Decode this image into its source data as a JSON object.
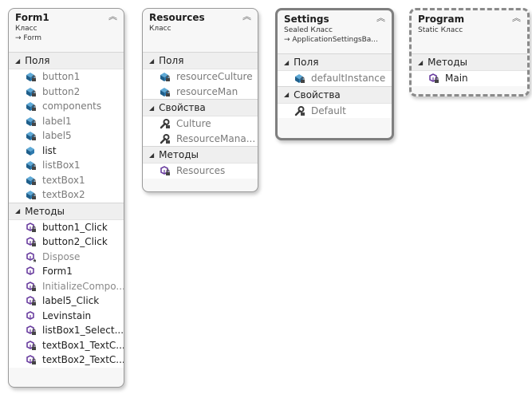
{
  "collapse_glyph": "︽",
  "form1": {
    "title": "Form1",
    "kind": "Класс",
    "base": "→ Form",
    "sections": {
      "fields": {
        "label": "Поля",
        "items": [
          {
            "name": "button1",
            "icon": "field-private-icon",
            "visibility": "private"
          },
          {
            "name": "button2",
            "icon": "field-private-icon",
            "visibility": "private"
          },
          {
            "name": "components",
            "icon": "field-private-icon",
            "visibility": "private"
          },
          {
            "name": "label1",
            "icon": "field-private-icon",
            "visibility": "private"
          },
          {
            "name": "label5",
            "icon": "field-private-icon",
            "visibility": "private"
          },
          {
            "name": "list",
            "icon": "field-public-icon",
            "visibility": "public"
          },
          {
            "name": "listBox1",
            "icon": "field-private-icon",
            "visibility": "private"
          },
          {
            "name": "textBox1",
            "icon": "field-private-icon",
            "visibility": "private"
          },
          {
            "name": "textBox2",
            "icon": "field-private-icon",
            "visibility": "private"
          }
        ]
      },
      "methods": {
        "label": "Методы",
        "items": [
          {
            "name": "button1_Click",
            "icon": "method-private-icon",
            "visibility": "public"
          },
          {
            "name": "button2_Click",
            "icon": "method-private-icon",
            "visibility": "public"
          },
          {
            "name": "Dispose",
            "icon": "method-protected-icon",
            "visibility": "protected"
          },
          {
            "name": "Form1",
            "icon": "method-public-icon",
            "visibility": "public"
          },
          {
            "name": "InitializeCompo...",
            "icon": "method-private-icon",
            "visibility": "protected"
          },
          {
            "name": "label5_Click",
            "icon": "method-private-icon",
            "visibility": "public"
          },
          {
            "name": "Levinstain",
            "icon": "method-public-icon",
            "visibility": "public"
          },
          {
            "name": "listBox1_Select...",
            "icon": "method-private-icon",
            "visibility": "public"
          },
          {
            "name": "textBox1_TextC...",
            "icon": "method-private-icon",
            "visibility": "public"
          },
          {
            "name": "textBox2_TextC...",
            "icon": "method-private-icon",
            "visibility": "public"
          }
        ]
      }
    }
  },
  "resources": {
    "title": "Resources",
    "kind": "Класс",
    "sections": {
      "fields": {
        "label": "Поля",
        "items": [
          {
            "name": "resourceCulture",
            "icon": "field-private-icon",
            "visibility": "private"
          },
          {
            "name": "resourceMan",
            "icon": "field-private-icon",
            "visibility": "private"
          }
        ]
      },
      "properties": {
        "label": "Свойства",
        "items": [
          {
            "name": "Culture",
            "icon": "property-icon",
            "visibility": "private"
          },
          {
            "name": "ResourceMana...",
            "icon": "property-icon",
            "visibility": "private"
          }
        ]
      },
      "methods": {
        "label": "Методы",
        "items": [
          {
            "name": "Resources",
            "icon": "method-private-icon",
            "visibility": "private"
          }
        ]
      }
    }
  },
  "settings": {
    "title": "Settings",
    "kind": "Sealed Класс",
    "base": "→ ApplicationSettingsBa...",
    "sections": {
      "fields": {
        "label": "Поля",
        "items": [
          {
            "name": "defaultInstance",
            "icon": "field-private-icon",
            "visibility": "private"
          }
        ]
      },
      "properties": {
        "label": "Свойства",
        "items": [
          {
            "name": "Default",
            "icon": "property-icon",
            "visibility": "private"
          }
        ]
      }
    }
  },
  "program": {
    "title": "Program",
    "kind": "Static Класс",
    "sections": {
      "methods": {
        "label": "Методы",
        "items": [
          {
            "name": "Main",
            "icon": "method-private-icon",
            "visibility": "public"
          }
        ]
      }
    }
  },
  "colors": {
    "field_blue": "#1f5f8b",
    "method_purple": "#6b3fa0",
    "property_gray": "#3a3a3a",
    "card_bg": "#f7f7f7",
    "section_bg": "#efefef"
  }
}
